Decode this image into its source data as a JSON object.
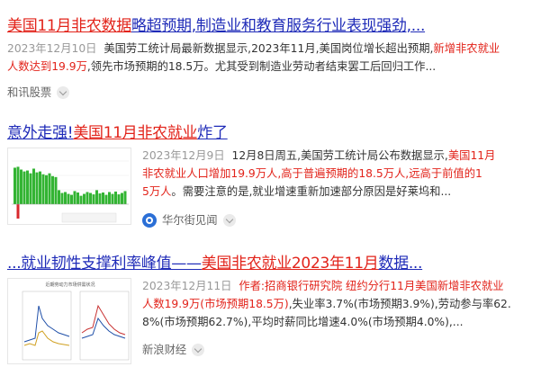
{
  "results": [
    {
      "title_hl": "美国11月非农数据",
      "title_rest": "略超预期,制造业和教育服务行业表现强劲,...",
      "date": "2023年12月10日",
      "snippet_plain1": "美国劳工统计局最新数据显示,2023年11月,美国岗位增长超出预期,",
      "snippet_red1": "新增非农就业",
      "snippet_red2": "人数达到19.9万",
      "snippet_plain2": ",领先市场预期的18.5万。尤其受到制造业劳动者结束罢工后回归工作...",
      "source": "和讯股票"
    },
    {
      "title_plain": "意外走强!",
      "title_hl": "美国11月非农就业",
      "title_rest": "炸了",
      "date": "2023年12月9日",
      "line1_plain": "12月8日周五,美国劳工统计局公布数据显示,",
      "line1_red": "美国11月",
      "line2_red": "非农就业人口增加19.9万人,高于普遍预期的18.5万人,远高于前值的1",
      "line3_red": "5万人",
      "line3_plain": "。需要注意的是,就业增速重新加速部分原因是好莱坞和...",
      "source": "华尔街见闻"
    },
    {
      "title_plain": "...就业韧性支撑利率峰值——",
      "title_hl": "美国非农就业2023年11月",
      "title_rest": "数据...",
      "date": "2023年12月11日",
      "line1_red": "作者:招商银行研究院 纽约分行11月美国新增非农就业",
      "line2_red": "人数19.9万(市场预期18.5万)",
      "line2_plain": ",失业率3.7%(市场预期3.9%),劳动参与率62.",
      "line3_plain": "8%(市场预期62.7%),平均时薪同比增速4.0%(市场预期4.0%),...",
      "source": "新浪财经",
      "thumb_title": "近期劳动力市场供需状况"
    }
  ],
  "colors": {
    "link": "#1f2bb8",
    "highlight": "#e2231a",
    "bar": "#33b433",
    "bar_negative": "#d8282d"
  },
  "icons": {
    "more": "chevron-down-icon",
    "wsj": "wallstreetcn-logo-icon"
  }
}
